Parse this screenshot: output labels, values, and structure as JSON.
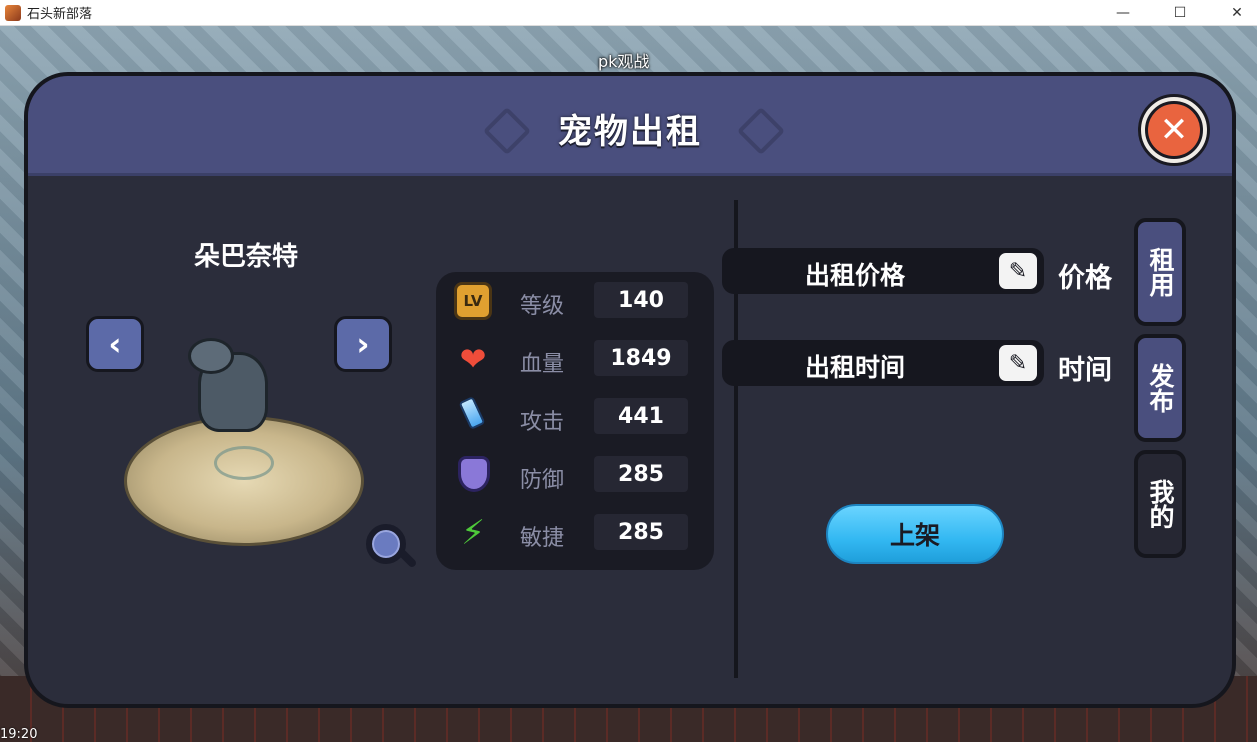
{
  "window": {
    "title": "石头新部落",
    "min_glyph": "—",
    "max_glyph": "☐",
    "close_glyph": "✕"
  },
  "background": {
    "pk_label": "pk观战",
    "clock": "19:20"
  },
  "dialog": {
    "title": "宠物出租",
    "close_glyph": "✕"
  },
  "pet": {
    "name": "朵巴奈特",
    "prev_glyph": "‹",
    "next_glyph": "›"
  },
  "stats": [
    {
      "icon": "level-icon",
      "icon_text": "LV",
      "label": "等级",
      "value": "140"
    },
    {
      "icon": "heart-icon",
      "icon_text": "❤",
      "label": "血量",
      "value": "1849"
    },
    {
      "icon": "sword-icon",
      "icon_text": "",
      "label": "攻击",
      "value": "441"
    },
    {
      "icon": "shield-icon",
      "icon_text": "",
      "label": "防御",
      "value": "285"
    },
    {
      "icon": "lightning-icon",
      "icon_text": "⚡",
      "label": "敏捷",
      "value": "285"
    }
  ],
  "rent": {
    "price_label": "出租价格",
    "price_value": "价格",
    "time_label": "出租时间",
    "time_value": "时间",
    "edit_glyph": "✎",
    "list_button": "上架"
  },
  "side_tabs": [
    {
      "label": "租用",
      "active": true
    },
    {
      "label": "发布",
      "active": true
    },
    {
      "label": "我的",
      "active": false
    }
  ],
  "colors": {
    "header": "#4a4f7e",
    "panel": "#2b2d3b",
    "accent_blue": "#33b8f2",
    "close_orange": "#e9643f"
  }
}
